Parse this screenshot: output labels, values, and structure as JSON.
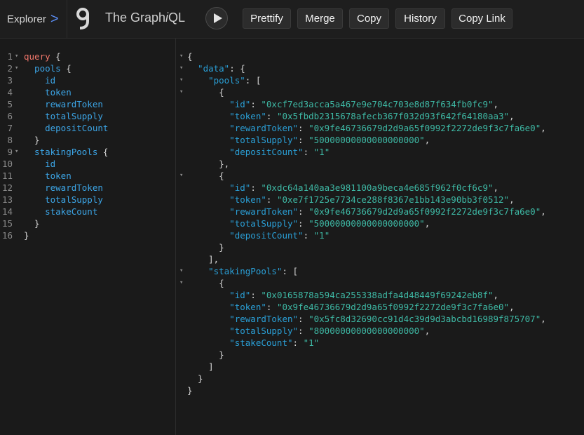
{
  "toolbar": {
    "explorer_label": "Explorer",
    "explorer_chevron": ">",
    "title_prefix": "The Graph",
    "title_i": "i",
    "title_suffix": "QL",
    "buttons": [
      "Prettify",
      "Merge",
      "Copy",
      "History",
      "Copy Link"
    ]
  },
  "query_lines": [
    {
      "n": "1",
      "parts": [
        {
          "c": "kw",
          "t": "query"
        },
        {
          "c": "brace",
          "t": " {"
        }
      ]
    },
    {
      "n": "2",
      "parts": [
        {
          "c": "fld",
          "t": "  pools"
        },
        {
          "c": "brace",
          "t": " {"
        }
      ]
    },
    {
      "n": "3",
      "parts": [
        {
          "c": "fld",
          "t": "    id"
        }
      ]
    },
    {
      "n": "4",
      "parts": [
        {
          "c": "fld",
          "t": "    token"
        }
      ]
    },
    {
      "n": "5",
      "parts": [
        {
          "c": "fld",
          "t": "    rewardToken"
        }
      ]
    },
    {
      "n": "6",
      "parts": [
        {
          "c": "fld",
          "t": "    totalSupply"
        }
      ]
    },
    {
      "n": "7",
      "parts": [
        {
          "c": "fld",
          "t": "    depositCount"
        }
      ]
    },
    {
      "n": "8",
      "parts": [
        {
          "c": "brace",
          "t": "  }"
        }
      ]
    },
    {
      "n": "9",
      "parts": [
        {
          "c": "fld",
          "t": "  stakingPools"
        },
        {
          "c": "brace",
          "t": " {"
        }
      ]
    },
    {
      "n": "10",
      "parts": [
        {
          "c": "fld",
          "t": "    id"
        }
      ]
    },
    {
      "n": "11",
      "parts": [
        {
          "c": "fld",
          "t": "    token"
        }
      ]
    },
    {
      "n": "12",
      "parts": [
        {
          "c": "fld",
          "t": "    rewardToken"
        }
      ]
    },
    {
      "n": "13",
      "parts": [
        {
          "c": "fld",
          "t": "    totalSupply"
        }
      ]
    },
    {
      "n": "14",
      "parts": [
        {
          "c": "fld",
          "t": "    stakeCount"
        }
      ]
    },
    {
      "n": "15",
      "parts": [
        {
          "c": "brace",
          "t": "  }"
        }
      ]
    },
    {
      "n": "16",
      "parts": [
        {
          "c": "brace",
          "t": "}"
        }
      ]
    }
  ],
  "result_lines": [
    {
      "parts": [
        {
          "c": "pun",
          "t": "{"
        }
      ]
    },
    {
      "parts": [
        {
          "c": "pq",
          "t": "  \"data\""
        },
        {
          "c": "pun",
          "t": ": {"
        }
      ]
    },
    {
      "parts": [
        {
          "c": "pq",
          "t": "    \"pools\""
        },
        {
          "c": "pun",
          "t": ": ["
        }
      ]
    },
    {
      "parts": [
        {
          "c": "pun",
          "t": "      {"
        }
      ]
    },
    {
      "parts": [
        {
          "c": "key",
          "t": "        \"id\""
        },
        {
          "c": "pun",
          "t": ": "
        },
        {
          "c": "str",
          "t": "\"0xcf7ed3acca5a467e9e704c703e8d87f634fb0fc9\""
        },
        {
          "c": "pun",
          "t": ","
        }
      ]
    },
    {
      "parts": [
        {
          "c": "key",
          "t": "        \"token\""
        },
        {
          "c": "pun",
          "t": ": "
        },
        {
          "c": "str",
          "t": "\"0x5fbdb2315678afecb367f032d93f642f64180aa3\""
        },
        {
          "c": "pun",
          "t": ","
        }
      ]
    },
    {
      "parts": [
        {
          "c": "key",
          "t": "        \"rewardToken\""
        },
        {
          "c": "pun",
          "t": ": "
        },
        {
          "c": "str",
          "t": "\"0x9fe46736679d2d9a65f0992f2272de9f3c7fa6e0\""
        },
        {
          "c": "pun",
          "t": ","
        }
      ]
    },
    {
      "parts": [
        {
          "c": "key",
          "t": "        \"totalSupply\""
        },
        {
          "c": "pun",
          "t": ": "
        },
        {
          "c": "str",
          "t": "\"50000000000000000000\""
        },
        {
          "c": "pun",
          "t": ","
        }
      ]
    },
    {
      "parts": [
        {
          "c": "key",
          "t": "        \"depositCount\""
        },
        {
          "c": "pun",
          "t": ": "
        },
        {
          "c": "str",
          "t": "\"1\""
        }
      ]
    },
    {
      "parts": [
        {
          "c": "pun",
          "t": "      },"
        }
      ]
    },
    {
      "parts": [
        {
          "c": "pun",
          "t": "      {"
        }
      ]
    },
    {
      "parts": [
        {
          "c": "key",
          "t": "        \"id\""
        },
        {
          "c": "pun",
          "t": ": "
        },
        {
          "c": "str",
          "t": "\"0xdc64a140aa3e981100a9beca4e685f962f0cf6c9\""
        },
        {
          "c": "pun",
          "t": ","
        }
      ]
    },
    {
      "parts": [
        {
          "c": "key",
          "t": "        \"token\""
        },
        {
          "c": "pun",
          "t": ": "
        },
        {
          "c": "str",
          "t": "\"0xe7f1725e7734ce288f8367e1bb143e90bb3f0512\""
        },
        {
          "c": "pun",
          "t": ","
        }
      ]
    },
    {
      "parts": [
        {
          "c": "key",
          "t": "        \"rewardToken\""
        },
        {
          "c": "pun",
          "t": ": "
        },
        {
          "c": "str",
          "t": "\"0x9fe46736679d2d9a65f0992f2272de9f3c7fa6e0\""
        },
        {
          "c": "pun",
          "t": ","
        }
      ]
    },
    {
      "parts": [
        {
          "c": "key",
          "t": "        \"totalSupply\""
        },
        {
          "c": "pun",
          "t": ": "
        },
        {
          "c": "str",
          "t": "\"50000000000000000000\""
        },
        {
          "c": "pun",
          "t": ","
        }
      ]
    },
    {
      "parts": [
        {
          "c": "key",
          "t": "        \"depositCount\""
        },
        {
          "c": "pun",
          "t": ": "
        },
        {
          "c": "str",
          "t": "\"1\""
        }
      ]
    },
    {
      "parts": [
        {
          "c": "pun",
          "t": "      }"
        }
      ]
    },
    {
      "parts": [
        {
          "c": "pun",
          "t": "    ],"
        }
      ]
    },
    {
      "parts": [
        {
          "c": "pq",
          "t": "    \"stakingPools\""
        },
        {
          "c": "pun",
          "t": ": ["
        }
      ]
    },
    {
      "parts": [
        {
          "c": "pun",
          "t": "      {"
        }
      ]
    },
    {
      "parts": [
        {
          "c": "key",
          "t": "        \"id\""
        },
        {
          "c": "pun",
          "t": ": "
        },
        {
          "c": "str",
          "t": "\"0x0165878a594ca255338adfa4d48449f69242eb8f\""
        },
        {
          "c": "pun",
          "t": ","
        }
      ]
    },
    {
      "parts": [
        {
          "c": "key",
          "t": "        \"token\""
        },
        {
          "c": "pun",
          "t": ": "
        },
        {
          "c": "str",
          "t": "\"0x9fe46736679d2d9a65f0992f2272de9f3c7fa6e0\""
        },
        {
          "c": "pun",
          "t": ","
        }
      ]
    },
    {
      "parts": [
        {
          "c": "key",
          "t": "        \"rewardToken\""
        },
        {
          "c": "pun",
          "t": ": "
        },
        {
          "c": "str",
          "t": "\"0x5fc8d32690cc91d4c39d9d3abcbd16989f875707\""
        },
        {
          "c": "pun",
          "t": ","
        }
      ]
    },
    {
      "parts": [
        {
          "c": "key",
          "t": "        \"totalSupply\""
        },
        {
          "c": "pun",
          "t": ": "
        },
        {
          "c": "str",
          "t": "\"80000000000000000000\""
        },
        {
          "c": "pun",
          "t": ","
        }
      ]
    },
    {
      "parts": [
        {
          "c": "key",
          "t": "        \"stakeCount\""
        },
        {
          "c": "pun",
          "t": ": "
        },
        {
          "c": "str",
          "t": "\"1\""
        }
      ]
    },
    {
      "parts": [
        {
          "c": "pun",
          "t": "      }"
        }
      ]
    },
    {
      "parts": [
        {
          "c": "pun",
          "t": "    ]"
        }
      ]
    },
    {
      "parts": [
        {
          "c": "pun",
          "t": "  }"
        }
      ]
    },
    {
      "parts": [
        {
          "c": "pun",
          "t": "}"
        }
      ]
    }
  ],
  "fold_marker": "▾",
  "colors": {
    "accent": "#5b8ef5",
    "keyword": "#f2776b",
    "field": "#3ca5e6",
    "string": "#3eb9a5",
    "background": "#1a1a1a"
  }
}
